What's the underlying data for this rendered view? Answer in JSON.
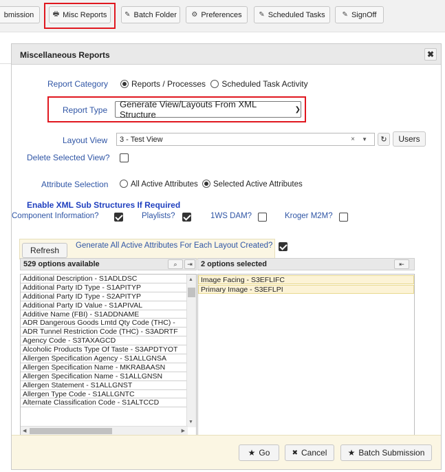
{
  "toolbar": {
    "items": [
      {
        "label": "bmission",
        "icon": ""
      },
      {
        "label": "Misc Reports",
        "icon": "printer-icon"
      },
      {
        "label": "Batch Folder",
        "icon": "pen-icon"
      },
      {
        "label": "Preferences",
        "icon": "gear-icon"
      },
      {
        "label": "Scheduled Tasks",
        "icon": "pen-icon"
      },
      {
        "label": "SignOff",
        "icon": "pen-icon"
      }
    ]
  },
  "dialog": {
    "title": "Miscellaneous Reports",
    "close_glyph": "✖"
  },
  "form": {
    "report_category": {
      "label": "Report Category",
      "options": [
        "Reports / Processes",
        "Scheduled Task Activity"
      ],
      "selected": "Reports / Processes"
    },
    "report_type": {
      "label": "Report Type",
      "value": "Generate View/Layouts From XML Structure"
    },
    "layout_view": {
      "label": "Layout View",
      "value": "3 - Test View",
      "users_label": "Users"
    },
    "delete_view": {
      "label": "Delete Selected View?",
      "checked": false
    },
    "attribute_selection": {
      "label": "Attribute Selection",
      "options": [
        "All Active Attributes",
        "Selected Active Attributes"
      ],
      "selected": "Selected Active Attributes"
    },
    "xml_sub": {
      "heading": "Enable XML Sub Structures If Required",
      "items": [
        {
          "label": "Component Information?",
          "checked": true
        },
        {
          "label": "Playlists?",
          "checked": true
        },
        {
          "label": "1WS DAM?",
          "checked": false
        },
        {
          "label": "Kroger M2M?",
          "checked": false
        }
      ]
    }
  },
  "attributes_panel": {
    "refresh_label": "Refresh",
    "generate_label": "Generate All Active Attributes For Each Layout Created?",
    "generate_checked": true,
    "available_header": "529 options available",
    "selected_header": "2 options selected",
    "available": [
      "Additional Description - S1ADLDSC",
      "Additional Party ID Type - S1APITYP",
      "Additional Party ID Type - S2APITYP",
      "Additional Party ID Value - S1APIVAL",
      "Additive Name (FBI) - S1ADDNAME",
      "ADR Dangerous Goods Lmtd Qty Code (THC) -",
      "ADR Tunnel Restriction Code (THC) - S3ADRTF",
      "Agency Code - S3TAXAGCD",
      "Alcoholic Products Type Of Taste - S3APDTYOT",
      "Allergen Specification Agency - S1ALLGNSA",
      "Allergen Specification Name - MKRABAASN",
      "Allergen Specification Name - S1ALLGNSN",
      "Allergen Statement - S1ALLGNST",
      "Allergen Type Code - S1ALLGNTC",
      "Alternate Classification Code - S1ALTCCD"
    ],
    "selected": [
      "Image Facing - S3EFLIFC",
      "Primary Image - S3EFLPI"
    ]
  },
  "footer": {
    "go_label": "Go",
    "cancel_label": "Cancel",
    "batch_label": "Batch Submission"
  },
  "colors": {
    "label_blue": "#2f55a5",
    "heading_blue": "#1f3fbf",
    "highlight_red": "#e0161e",
    "panel_cream": "#fbf6e3"
  }
}
